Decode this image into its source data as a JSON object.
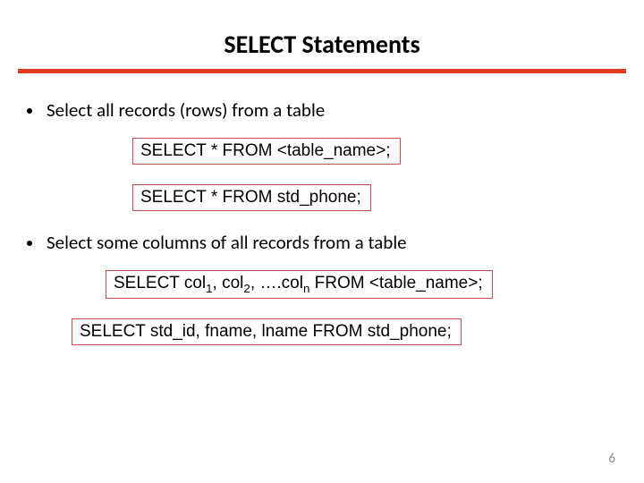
{
  "title": "SELECT Statements",
  "bullets": {
    "b1": "Select all records (rows) from a table",
    "b2": "Select some columns of all records from a table"
  },
  "code": {
    "c1": "SELECT  *  FROM  <table_name>;",
    "c2": "SELECT  *  FROM  std_phone;",
    "c3_pre": "SELECT  col",
    "c3_s1": "1",
    "c3_m1": ", col",
    "c3_s2": "2",
    "c3_m2": ", ….col",
    "c3_s3": "n",
    "c3_post": "  FROM  <table_name>;",
    "c4": "SELECT  std_id, fname, lname  FROM  std_phone;"
  },
  "pagenum": "6"
}
